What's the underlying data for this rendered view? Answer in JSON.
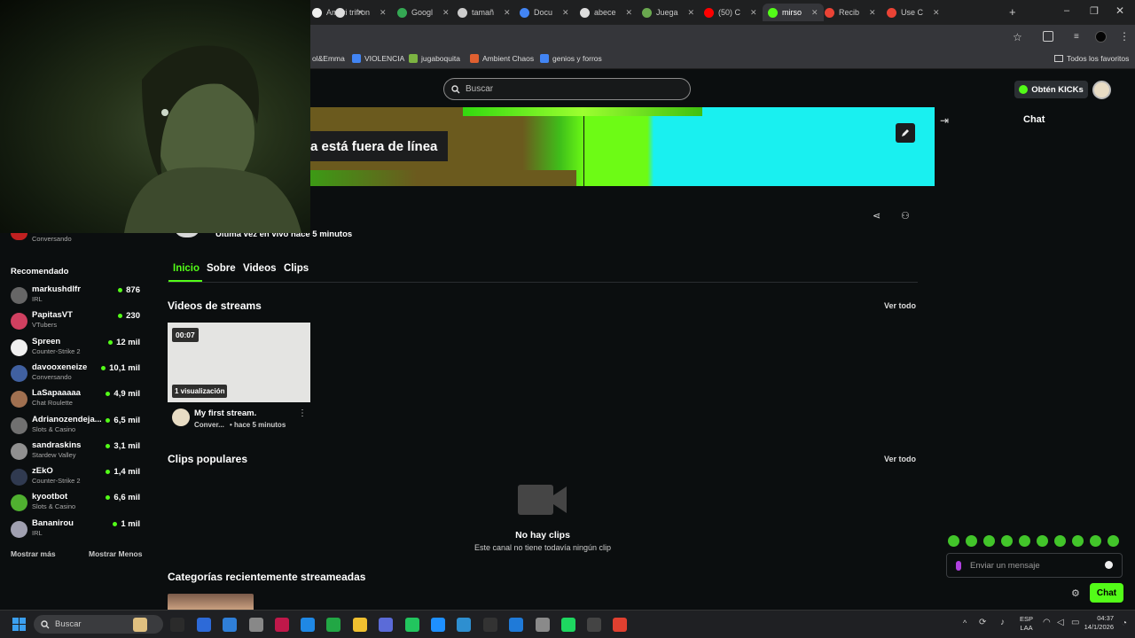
{
  "browser": {
    "tabs": [
      {
        "label": "Améri",
        "color": "#f0f0f0"
      },
      {
        "label": "trifron",
        "color": "#dddddd"
      },
      {
        "label": "Googl",
        "color": "#34a853"
      },
      {
        "label": "tamañ",
        "color": "#cccccc"
      },
      {
        "label": "Docu",
        "color": "#4285f4"
      },
      {
        "label": "abece",
        "color": "#dddddd"
      },
      {
        "label": "Juega",
        "color": "#6aa84f"
      },
      {
        "label": "(50) C",
        "color": "#ff0000"
      },
      {
        "label": "mirso",
        "color": "#53fc18"
      },
      {
        "label": "Recib",
        "color": "#ea4335"
      },
      {
        "label": "Use C",
        "color": "#ea4335"
      }
    ],
    "new_tab": "+",
    "bookmarks": [
      {
        "label": "ol&Emma",
        "color": "#888888"
      },
      {
        "label": "VIOLENCIA",
        "color": "#4285f4"
      },
      {
        "label": "jugaboquita",
        "color": "#7cb342"
      },
      {
        "label": "Ambient Chaos",
        "color": "#e06030"
      },
      {
        "label": "genios y forros",
        "color": "#4285f4"
      }
    ],
    "all_bookmarks": "Todos los favoritos"
  },
  "header": {
    "search_placeholder": "Buscar",
    "kicks_button": "Obtén KICKs"
  },
  "banner": {
    "offline_text": "a está fuera de línea"
  },
  "channel": {
    "last_live": "Última vez en vivo hace 5 minutos",
    "tabs": [
      "Inicio",
      "Sobre",
      "Videos",
      "Clips"
    ]
  },
  "sidebar": {
    "following_partial": {
      "category": "Conversando"
    },
    "recommended_title": "Recomendado",
    "channels": [
      {
        "name": "markushdlfr",
        "category": "IRL",
        "viewers": "876",
        "color": "#666666"
      },
      {
        "name": "PapitasVT",
        "category": "VTubers",
        "viewers": "230",
        "color": "#d04060"
      },
      {
        "name": "Spreen",
        "category": "Counter-Strike 2",
        "viewers": "12 mil",
        "color": "#f0f0f0"
      },
      {
        "name": "davooxeneize",
        "category": "Conversando",
        "viewers": "10,1 mil",
        "color": "#4060a0"
      },
      {
        "name": "LaSapaaaaa",
        "category": "Chat Roulette",
        "viewers": "4,9 mil",
        "color": "#a07050"
      },
      {
        "name": "Adrianozendeja...",
        "category": "Slots & Casino",
        "viewers": "6,5 mil",
        "color": "#707070"
      },
      {
        "name": "sandraskins",
        "category": "Stardew Valley",
        "viewers": "3,1 mil",
        "color": "#909090"
      },
      {
        "name": "zEkO",
        "category": "Counter-Strike 2",
        "viewers": "1,4 mil",
        "color": "#303a50"
      },
      {
        "name": "kyootbot",
        "category": "Slots & Casino",
        "viewers": "6,6 mil",
        "color": "#50b030"
      },
      {
        "name": "Bananirou",
        "category": "IRL",
        "viewers": "1 mil",
        "color": "#a0a0b0"
      }
    ],
    "show_more": "Mostrar más",
    "show_less": "Mostrar Menos"
  },
  "main": {
    "streams_title": "Videos de streams",
    "view_all": "Ver todo",
    "video": {
      "duration": "00:07",
      "views": "1 visualización",
      "title": "My first stream.",
      "category": "Conver...",
      "age": "• hace 5 minutos"
    },
    "clips_title": "Clips populares",
    "no_clips": "No hay clips",
    "no_clips_sub": "Este canal no tiene todavía ningún clip",
    "categories_title": "Categorías recientemente streameadas"
  },
  "chat": {
    "title": "Chat",
    "placeholder": "Enviar un mensaje",
    "send": "Chat"
  },
  "taskbar": {
    "search": "Buscar",
    "lang": "ESP",
    "lang2": "LAA",
    "time": "04:37",
    "date": "14/1/2026"
  },
  "colors": {
    "accent": "#53fc18",
    "background": "#0b0e0f"
  }
}
